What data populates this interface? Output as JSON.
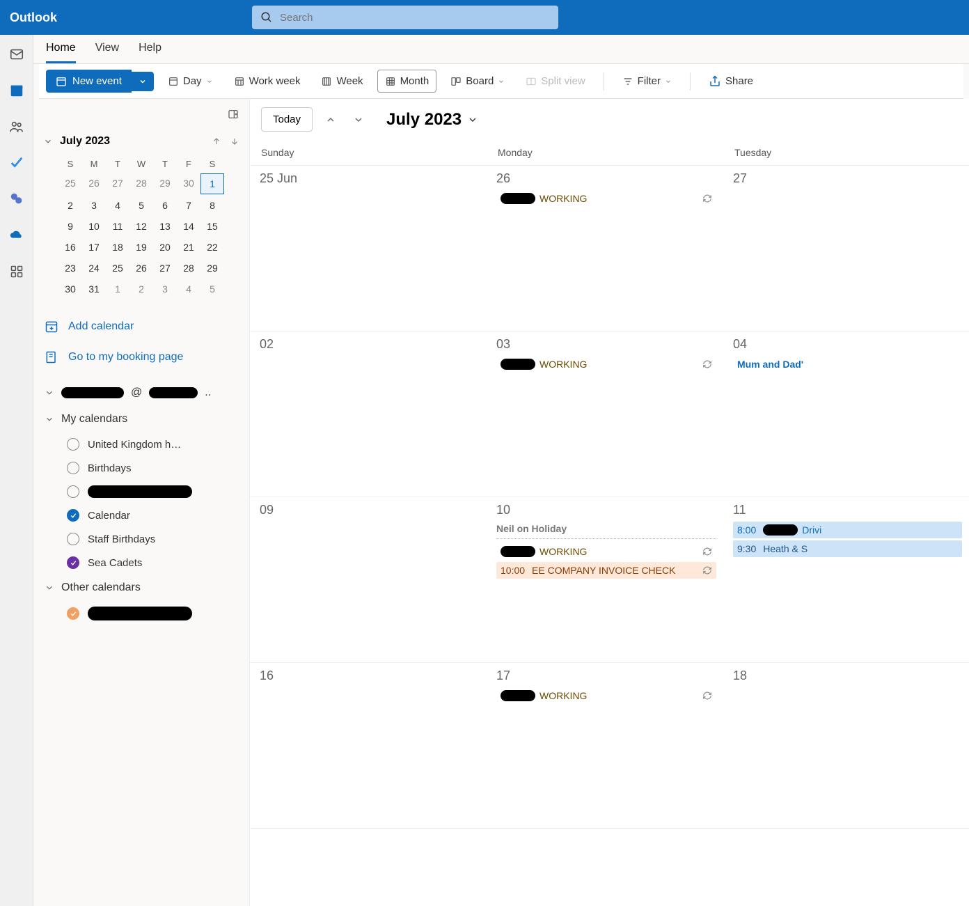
{
  "brand": "Outlook",
  "search": {
    "placeholder": "Search"
  },
  "tabs": {
    "home": "Home",
    "view": "View",
    "help": "Help"
  },
  "ribbon": {
    "new_event": "New event",
    "day": "Day",
    "work_week": "Work week",
    "week": "Week",
    "month": "Month",
    "board": "Board",
    "split_view": "Split view",
    "filter": "Filter",
    "share": "Share"
  },
  "mini": {
    "title": "July 2023",
    "dow": [
      "S",
      "M",
      "T",
      "W",
      "T",
      "F",
      "S"
    ],
    "rows": [
      [
        {
          "d": "25",
          "o": true
        },
        {
          "d": "26",
          "o": true
        },
        {
          "d": "27",
          "o": true
        },
        {
          "d": "28",
          "o": true
        },
        {
          "d": "29",
          "o": true
        },
        {
          "d": "30",
          "o": true
        },
        {
          "d": "1",
          "sel": true
        }
      ],
      [
        {
          "d": "2"
        },
        {
          "d": "3"
        },
        {
          "d": "4"
        },
        {
          "d": "5"
        },
        {
          "d": "6"
        },
        {
          "d": "7"
        },
        {
          "d": "8"
        }
      ],
      [
        {
          "d": "9"
        },
        {
          "d": "10"
        },
        {
          "d": "11"
        },
        {
          "d": "12"
        },
        {
          "d": "13"
        },
        {
          "d": "14"
        },
        {
          "d": "15"
        }
      ],
      [
        {
          "d": "16"
        },
        {
          "d": "17"
        },
        {
          "d": "18"
        },
        {
          "d": "19"
        },
        {
          "d": "20"
        },
        {
          "d": "21"
        },
        {
          "d": "22"
        }
      ],
      [
        {
          "d": "23"
        },
        {
          "d": "24"
        },
        {
          "d": "25"
        },
        {
          "d": "26"
        },
        {
          "d": "27"
        },
        {
          "d": "28"
        },
        {
          "d": "29"
        }
      ],
      [
        {
          "d": "30"
        },
        {
          "d": "31"
        },
        {
          "d": "1",
          "o": true
        },
        {
          "d": "2",
          "o": true
        },
        {
          "d": "3",
          "o": true
        },
        {
          "d": "4",
          "o": true
        },
        {
          "d": "5",
          "o": true
        }
      ]
    ]
  },
  "sidelinks": {
    "add_calendar": "Add calendar",
    "booking": "Go to my booking page"
  },
  "sections": {
    "account": "..",
    "my_calendars": "My calendars",
    "other_calendars": "Other calendars"
  },
  "calendars": {
    "uk": "United Kingdom h…",
    "birthdays": "Birthdays",
    "redacted1": "",
    "calendar": "Calendar",
    "staff_birthdays": "Staff Birthdays",
    "sea_cadets": "Sea Cadets",
    "other_redacted": ""
  },
  "calmain": {
    "today": "Today",
    "title": "July 2023",
    "dow": {
      "sun": "Sunday",
      "mon": "Monday",
      "tue": "Tuesday"
    },
    "rows": [
      {
        "sun": "25 Jun",
        "mon": "26",
        "tue": "27",
        "mon_evts": [
          {
            "type": "brown",
            "redact": true,
            "text": "WORKING",
            "recur": true
          }
        ]
      },
      {
        "sun": "02",
        "mon": "03",
        "tue": "04",
        "mon_evts": [
          {
            "type": "brown",
            "redact": true,
            "text": "WORKING",
            "recur": true
          }
        ],
        "tue_evts": [
          {
            "type": "blue",
            "text": "Mum and Dad'"
          }
        ]
      },
      {
        "sun": "09",
        "mon": "10",
        "tue": "11",
        "mon_allday": "Neil on Holiday",
        "mon_evts": [
          {
            "type": "brown",
            "redact": true,
            "text": " WORKING",
            "recur": true
          },
          {
            "type": "beigebg",
            "time": "10:00",
            "text": "EE COMPANY INVOICE CHECK",
            "recur": true
          }
        ],
        "tue_evts": [
          {
            "type": "ltbluebg",
            "time": "8:00",
            "redact": true,
            "text": "Drivi"
          },
          {
            "type": "ltbluebg2",
            "time": "9:30",
            "text": "Heath & S"
          }
        ]
      },
      {
        "sun": "16",
        "mon": "17",
        "tue": "18",
        "mon_evts": [
          {
            "type": "brown",
            "redact": true,
            "text": "WORKING",
            "recur": true
          }
        ]
      }
    ]
  }
}
